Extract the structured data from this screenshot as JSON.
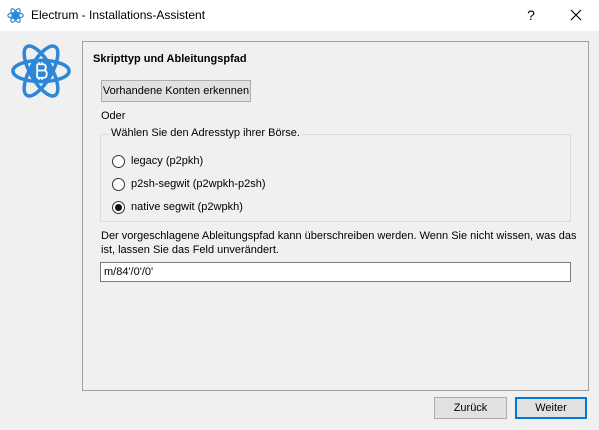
{
  "window": {
    "title": "Electrum  -  Installations-Assistent",
    "help_label": "?"
  },
  "panel": {
    "heading": "Skripttyp und Ableitungspfad",
    "detect_button": "Vorhandene Konten erkennen",
    "or_label": "Oder",
    "group_legend": "Wählen Sie den Adresstyp ihrer Börse.",
    "options": [
      {
        "label": "legacy (p2pkh)",
        "selected": false
      },
      {
        "label": "p2sh-segwit (p2wpkh-p2sh)",
        "selected": false
      },
      {
        "label": "native segwit (p2wpkh)",
        "selected": true
      }
    ],
    "info_text": "Der vorgeschlagene Ableitungspfad kann überschreiben werden. Wenn Sie nicht wissen, was das ist, lassen Sie das Feld unverändert.",
    "path_value": "m/84'/0'/0'"
  },
  "footer": {
    "back_label": "Zurück",
    "next_label": "Weiter"
  },
  "colors": {
    "logo_blue": "#2d86d6",
    "focus_border": "#0078d7"
  }
}
